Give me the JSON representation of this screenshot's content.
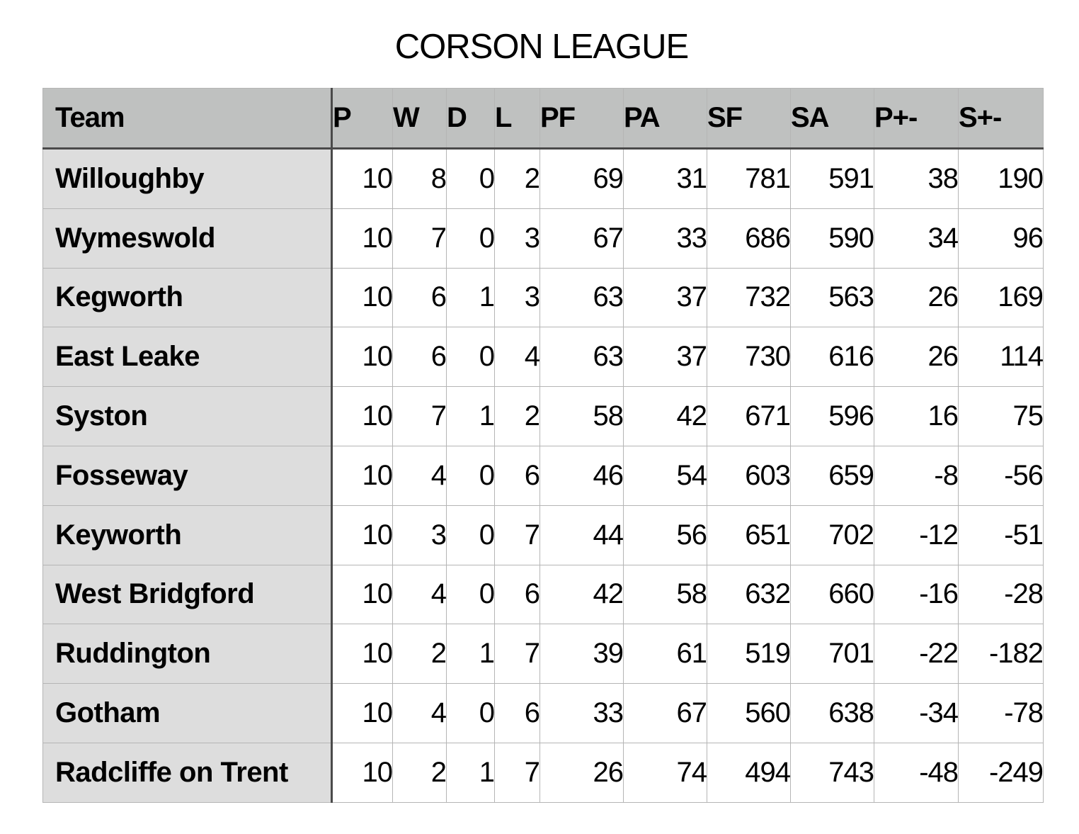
{
  "title": "CORSON LEAGUE",
  "table": {
    "headers": [
      "Team",
      "P",
      "W",
      "D",
      "L",
      "PF",
      "PA",
      "SF",
      "SA",
      "P+-",
      "S+-"
    ],
    "rows": [
      {
        "team": "Willoughby",
        "values": [
          "10",
          "8",
          "0",
          "2",
          "69",
          "31",
          "781",
          "591",
          "38",
          "190"
        ]
      },
      {
        "team": "Wymeswold",
        "values": [
          "10",
          "7",
          "0",
          "3",
          "67",
          "33",
          "686",
          "590",
          "34",
          "96"
        ]
      },
      {
        "team": "Kegworth",
        "values": [
          "10",
          "6",
          "1",
          "3",
          "63",
          "37",
          "732",
          "563",
          "26",
          "169"
        ]
      },
      {
        "team": "East Leake",
        "values": [
          "10",
          "6",
          "0",
          "4",
          "63",
          "37",
          "730",
          "616",
          "26",
          "114"
        ]
      },
      {
        "team": "Syston",
        "values": [
          "10",
          "7",
          "1",
          "2",
          "58",
          "42",
          "671",
          "596",
          "16",
          "75"
        ]
      },
      {
        "team": "Fosseway",
        "values": [
          "10",
          "4",
          "0",
          "6",
          "46",
          "54",
          "603",
          "659",
          "-8",
          "-56"
        ]
      },
      {
        "team": "Keyworth",
        "values": [
          "10",
          "3",
          "0",
          "7",
          "44",
          "56",
          "651",
          "702",
          "-12",
          "-51"
        ]
      },
      {
        "team": "West Bridgford",
        "values": [
          "10",
          "4",
          "0",
          "6",
          "42",
          "58",
          "632",
          "660",
          "-16",
          "-28"
        ]
      },
      {
        "team": "Ruddington",
        "values": [
          "10",
          "2",
          "1",
          "7",
          "39",
          "61",
          "519",
          "701",
          "-22",
          "-182"
        ]
      },
      {
        "team": "Gotham",
        "values": [
          "10",
          "4",
          "0",
          "6",
          "33",
          "67",
          "560",
          "638",
          "-34",
          "-78"
        ]
      },
      {
        "team": "Radcliffe on Trent",
        "values": [
          "10",
          "2",
          "1",
          "7",
          "26",
          "74",
          "494",
          "743",
          "-48",
          "-249"
        ]
      }
    ]
  },
  "colors": {
    "header_bg": "#bfc1c0",
    "team_col_bg": "#dddddd",
    "grid_line": "#b5b5b5",
    "divider_line": "#4a4a4a"
  }
}
